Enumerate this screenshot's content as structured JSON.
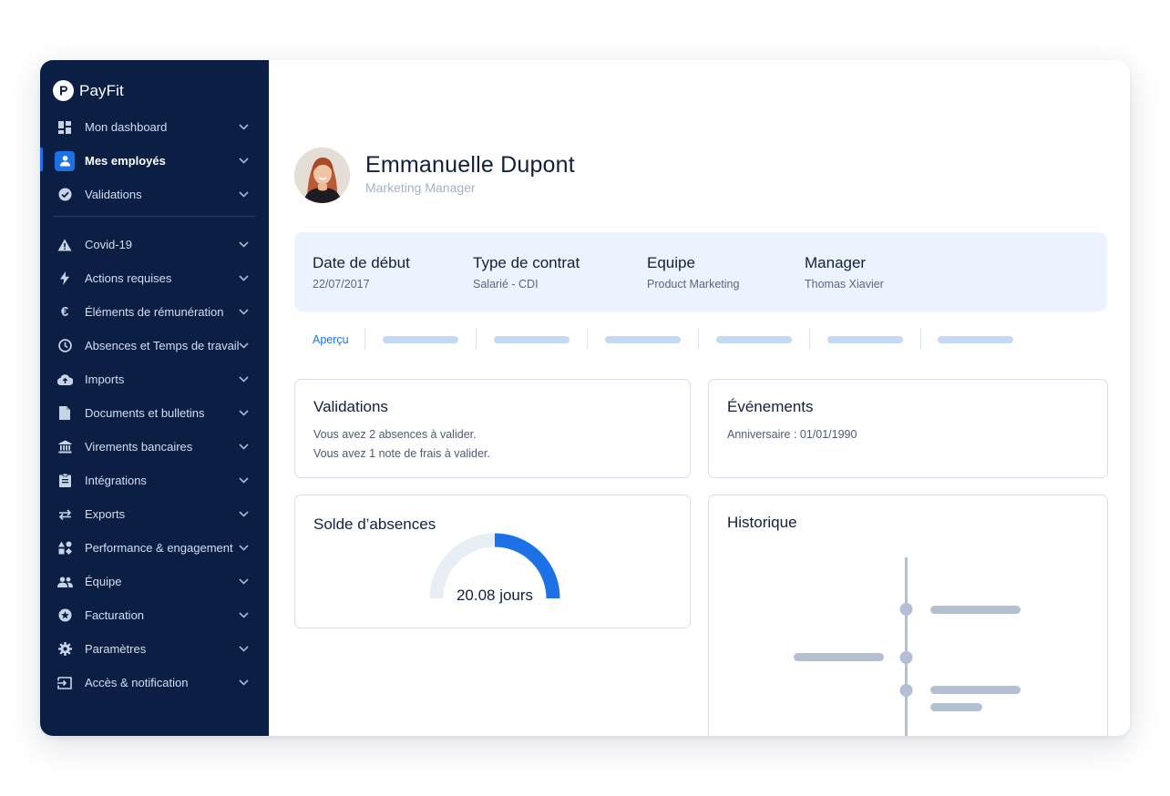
{
  "brand": {
    "name": "PayFit"
  },
  "sidebar": {
    "items": [
      {
        "label": "Mon dashboard",
        "icon": "dashboard-icon",
        "active": false
      },
      {
        "label": "Mes employés",
        "icon": "person-icon",
        "active": true
      },
      {
        "label": "Validations",
        "icon": "check-circle-icon",
        "active": false
      },
      {
        "label": "Covid-19",
        "icon": "warning-icon",
        "active": false
      },
      {
        "label": "Actions requises",
        "icon": "lightning-icon",
        "active": false
      },
      {
        "label": "Éléments de rémunération",
        "icon": "euro-icon",
        "active": false
      },
      {
        "label": "Absences et Temps de travail",
        "icon": "clock-icon",
        "active": false
      },
      {
        "label": "Imports",
        "icon": "cloud-upload-icon",
        "active": false
      },
      {
        "label": "Documents et bulletins",
        "icon": "document-icon",
        "active": false
      },
      {
        "label": "Virements bancaires",
        "icon": "bank-icon",
        "active": false
      },
      {
        "label": "Intégrations",
        "icon": "clipboard-icon",
        "active": false
      },
      {
        "label": "Exports",
        "icon": "swap-arrows-icon",
        "active": false
      },
      {
        "label": "Performance & engagement",
        "icon": "shapes-icon",
        "active": false
      },
      {
        "label": "Équipe",
        "icon": "people-icon",
        "active": false
      },
      {
        "label": "Facturation",
        "icon": "star-circle-icon",
        "active": false
      },
      {
        "label": "Paramètres",
        "icon": "gear-icon",
        "active": false
      },
      {
        "label": "Accès & notification",
        "icon": "login-icon",
        "active": false
      }
    ]
  },
  "employee": {
    "name": "Emmanuelle Dupont",
    "role": "Marketing Manager"
  },
  "info": [
    {
      "label": "Date de début",
      "value": "22/07/2017"
    },
    {
      "label": "Type de contrat",
      "value": "Salarié - CDI"
    },
    {
      "label": "Equipe",
      "value": "Product Marketing"
    },
    {
      "label": "Manager",
      "value": "Thomas Xiavier"
    }
  ],
  "tabs": {
    "active": "Aperçu"
  },
  "validations": {
    "title": "Validations",
    "lines": [
      "Vous avez 2 absences à valider.",
      "Vous avez 1 note de frais à valider."
    ]
  },
  "events": {
    "title": "Événements",
    "lines": [
      "Anniversaire : 01/01/1990"
    ]
  },
  "absences": {
    "title": "Solde d’absences",
    "value_label": "20.08 jours",
    "fraction": 0.5
  },
  "history": {
    "title": "Historique"
  },
  "colors": {
    "sidebar_bg": "#0b1f44",
    "accent": "#1d71e6",
    "band_bg": "#ebf3fe",
    "placeholder": "#c4d9f3",
    "timeline": "#b3c0d4"
  }
}
